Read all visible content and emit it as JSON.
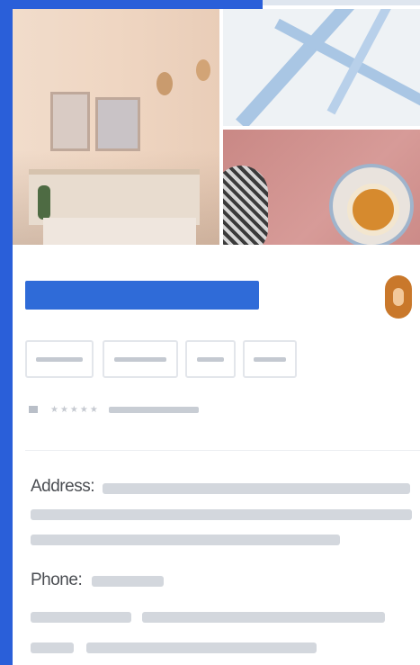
{
  "colors": {
    "frame": "#2a5fd9",
    "title_bar": "#2f6bd8",
    "placeholder": "#d3d7dd",
    "chip_border": "#e3e6eb",
    "place_icon": "#c9782b"
  },
  "icons": {
    "place_icon": "place-marker-icon"
  },
  "rating": {
    "stars": "★★★★★"
  },
  "details": {
    "address_label": "Address:",
    "phone_label": "Phone:"
  }
}
